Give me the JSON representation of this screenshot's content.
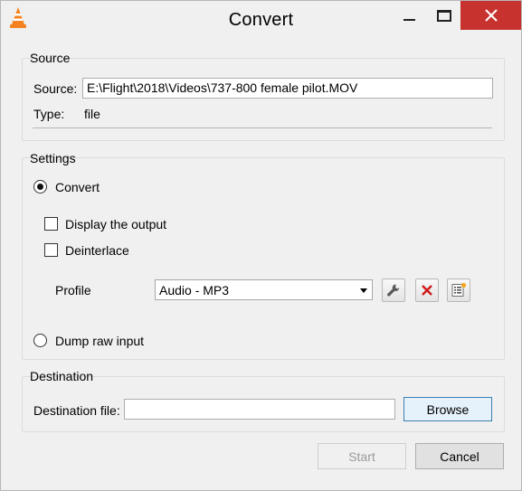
{
  "window": {
    "title": "Convert",
    "app_icon": "vlc-cone-icon"
  },
  "source": {
    "group_title": "Source",
    "source_label": "Source:",
    "source_value": "E:\\Flight\\2018\\Videos\\737-800 female pilot.MOV",
    "type_label": "Type:",
    "type_value": "file"
  },
  "settings": {
    "group_title": "Settings",
    "convert_label": "Convert",
    "convert_selected": true,
    "display_output_label": "Display the output",
    "display_output_checked": false,
    "deinterlace_label": "Deinterlace",
    "deinterlace_checked": false,
    "profile_label": "Profile",
    "profile_value": "Audio - MP3",
    "dump_raw_label": "Dump raw input",
    "dump_raw_selected": false
  },
  "destination": {
    "group_title": "Destination",
    "file_label": "Destination file:",
    "file_value": "",
    "browse_label": "Browse"
  },
  "footer": {
    "start_label": "Start",
    "cancel_label": "Cancel"
  },
  "colors": {
    "close_button": "#c7312e",
    "vlc_orange": "#f58220",
    "delete_red": "#d01818"
  }
}
